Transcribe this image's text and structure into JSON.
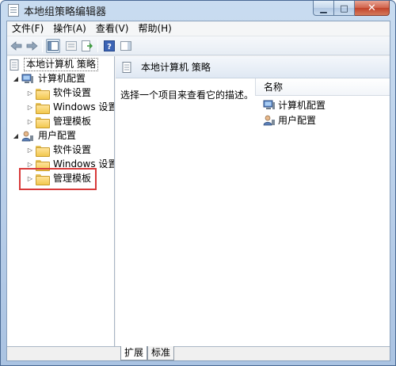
{
  "window": {
    "title": "本地组策略编辑器",
    "minimize_glyph": "▁",
    "maximize_glyph": "□",
    "close_glyph": "✕"
  },
  "menu": [
    "文件(F)",
    "操作(A)",
    "查看(V)",
    "帮助(H)"
  ],
  "toolbar": {
    "icons": [
      "back-arrow-icon",
      "forward-arrow-icon",
      "show-hide-tree-icon",
      "properties-icon",
      "export-list-icon",
      "help-icon",
      "show-hide-action-pane-icon"
    ]
  },
  "tree": {
    "root": "本地计算机 策略",
    "computer_config": "计算机配置",
    "software_settings_1": "软件设置",
    "windows_settings_1": "Windows 设置",
    "admin_templates_1": "管理模板",
    "user_config": "用户配置",
    "software_settings_2": "软件设置",
    "windows_settings_2": "Windows 设置",
    "admin_templates_2": "管理模板"
  },
  "right": {
    "header_title": "本地计算机 策略",
    "description": "选择一个项目来查看它的描述。",
    "column_name": "名称",
    "items": [
      "计算机配置",
      "用户配置"
    ]
  },
  "tabs": [
    "扩展",
    "标准"
  ],
  "colors": {
    "highlight_box": "#d83a3a",
    "title_bar": "#b7cde8",
    "folder": "#f2c84f"
  }
}
